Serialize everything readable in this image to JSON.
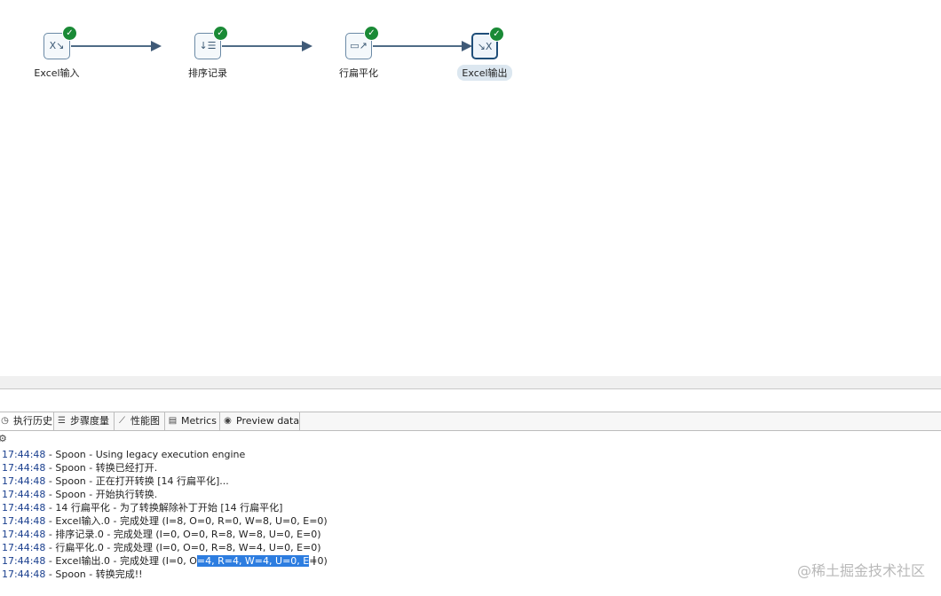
{
  "canvas": {
    "steps": [
      {
        "label": "Excel输入",
        "icon": "excel-input-icon",
        "status": "success"
      },
      {
        "label": "排序记录",
        "icon": "sort-rows-icon",
        "status": "success"
      },
      {
        "label": "行扁平化",
        "icon": "row-flattener-icon",
        "status": "success"
      },
      {
        "label": "Excel输出",
        "icon": "excel-output-icon",
        "status": "success",
        "selected": true
      }
    ]
  },
  "tabs": [
    {
      "label": "执行历史",
      "icon": "history-icon"
    },
    {
      "label": "步骤度量",
      "icon": "step-metrics-icon"
    },
    {
      "label": "性能图",
      "icon": "performance-chart-icon"
    },
    {
      "label": "Metrics",
      "icon": "metrics-icon"
    },
    {
      "label": "Preview data",
      "icon": "preview-eye-icon"
    }
  ],
  "log": {
    "lines": [
      {
        "time": "17:44:48",
        "text": " - Spoon - Using legacy execution engine"
      },
      {
        "time": "17:44:48",
        "text": " - Spoon - 转换已经打开."
      },
      {
        "time": "17:44:48",
        "text": " - Spoon - 正在打开转换 [14 行扁平化]..."
      },
      {
        "time": "17:44:48",
        "text": " - Spoon - 开始执行转换."
      },
      {
        "time": "17:44:48",
        "text": " - 14 行扁平化 - 为了转换解除补丁开始  [14 行扁平化]"
      },
      {
        "time": "17:44:48",
        "text": " - Excel输入.0 - 完成处理 (I=8, O=0, R=0, W=8, U=0, E=0)"
      },
      {
        "time": "17:44:48",
        "text": " - 排序记录.0 - 完成处理 (I=0, O=0, R=8, W=8, U=0, E=0)"
      },
      {
        "time": "17:44:48",
        "text": " - 行扁平化.0 - 完成处理 (I=0, O=0, R=8, W=4, U=0, E=0)"
      },
      {
        "time": "17:44:48",
        "text_before": " - Excel输出.0 - 完成处理 (I=0, O",
        "text_highlight": "=4, R=4, W=4, U=0, E",
        "text_after": "=0)"
      },
      {
        "time": "17:44:48",
        "text": " - Spoon - 转换完成!!"
      }
    ]
  },
  "watermark": "@稀土掘金技术社区"
}
